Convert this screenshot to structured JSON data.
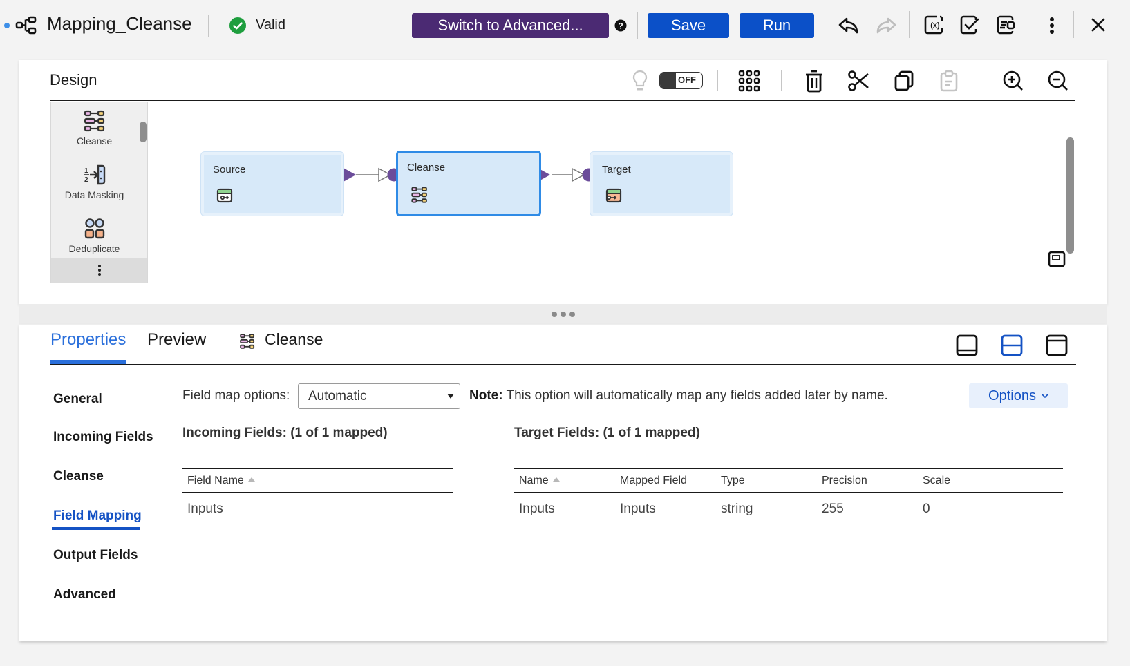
{
  "header": {
    "title": "Mapping_Cleanse",
    "status": "Valid",
    "advanced_button": "Switch to Advanced...",
    "save_button": "Save",
    "run_button": "Run",
    "colors": {
      "advanced": "#4b2a73",
      "primary": "#0b50c8",
      "valid": "#1e9e3e"
    }
  },
  "design": {
    "title": "Design",
    "toggle_label": "OFF",
    "palette": [
      {
        "label": "Cleanse",
        "icon": "cleanse-icon"
      },
      {
        "label": "Data Masking",
        "icon": "data-masking-icon"
      },
      {
        "label": "Deduplicate",
        "icon": "deduplicate-icon"
      }
    ],
    "nodes": [
      {
        "label": "Source",
        "icon": "source-icon",
        "selected": false
      },
      {
        "label": "Cleanse",
        "icon": "cleanse-icon",
        "selected": true
      },
      {
        "label": "Target",
        "icon": "target-icon",
        "selected": false
      }
    ]
  },
  "properties": {
    "tabs": [
      {
        "label": "Properties",
        "active": true
      },
      {
        "label": "Preview",
        "active": false
      }
    ],
    "context_label": "Cleanse",
    "nav": [
      {
        "label": "General"
      },
      {
        "label": "Incoming Fields"
      },
      {
        "label": "Cleanse"
      },
      {
        "label": "Field Mapping",
        "active": true
      },
      {
        "label": "Output Fields"
      },
      {
        "label": "Advanced"
      }
    ],
    "field_map_label": "Field map options:",
    "field_map_value": "Automatic",
    "note_prefix": "Note:",
    "note_text": " This option will automatically map any fields added later by name.",
    "options_button": "Options",
    "incoming": {
      "title": "Incoming Fields: (1 of 1 mapped)",
      "columns": [
        "Field Name"
      ],
      "rows": [
        [
          "Inputs"
        ]
      ]
    },
    "target": {
      "title": "Target Fields: (1 of 1 mapped)",
      "columns": [
        "Name",
        "Mapped Field",
        "Type",
        "Precision",
        "Scale"
      ],
      "rows": [
        [
          "Inputs",
          "Inputs",
          "string",
          "255",
          "0"
        ]
      ]
    }
  }
}
